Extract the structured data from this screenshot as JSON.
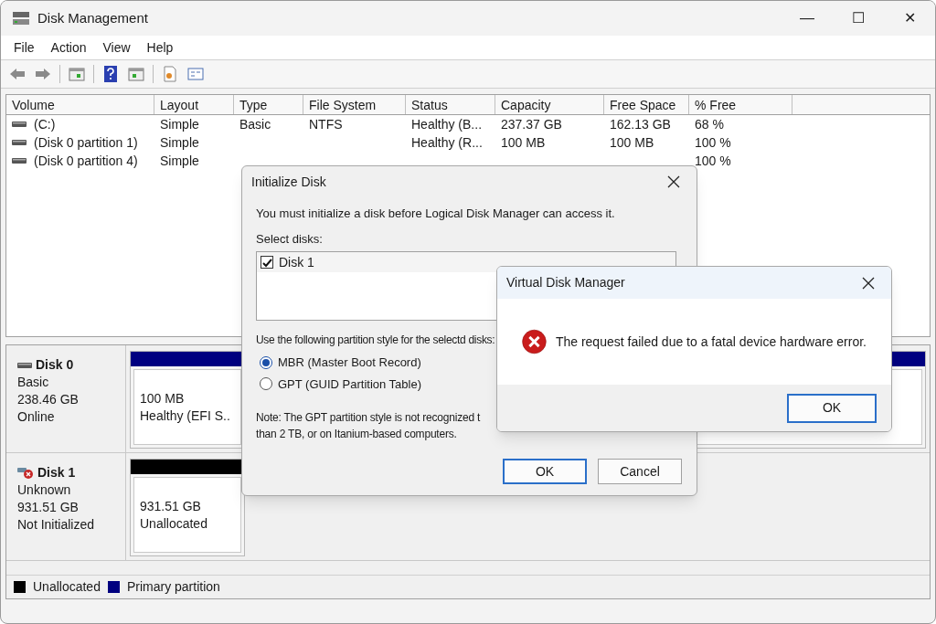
{
  "window": {
    "title": "Disk Management",
    "controls": [
      "—",
      "☐",
      "✕"
    ]
  },
  "menu": [
    "File",
    "Action",
    "View",
    "Help"
  ],
  "table": {
    "columns": [
      "Volume",
      "Layout",
      "Type",
      "File System",
      "Status",
      "Capacity",
      "Free Space",
      "% Free"
    ],
    "rows": [
      {
        "volume": "(C:)",
        "layout": "Simple",
        "type": "Basic",
        "file_system": "NTFS",
        "status": "Healthy (B...",
        "capacity": "237.37 GB",
        "free_space": "162.13 GB",
        "percent_free": "68 %"
      },
      {
        "volume": "(Disk 0 partition 1)",
        "layout": "Simple",
        "status": "Healthy (R...",
        "capacity": "100 MB",
        "free_space": "100 MB",
        "percent_free": "100 %"
      },
      {
        "volume": "(Disk 0 partition 4)",
        "layout": "Simple",
        "percent_free": "100 %"
      }
    ]
  },
  "disks": [
    {
      "name": "Disk 0",
      "error": false,
      "lines": [
        "Basic",
        "238.46 GB",
        "Online"
      ],
      "partitions": [
        {
          "color": "#000080",
          "size": "100 MB",
          "status": "Healthy (EFI S.."
        },
        {
          "color": "#000080"
        }
      ]
    },
    {
      "name": "Disk 1",
      "error": true,
      "lines": [
        "Unknown",
        "931.51 GB",
        "Not Initialized"
      ],
      "partitions": [
        {
          "color": "#000000",
          "size": "931.51 GB",
          "status": "Unallocated"
        }
      ]
    }
  ],
  "legend": [
    {
      "label": "Unallocated",
      "color": "#000000"
    },
    {
      "label": "Primary partition",
      "color": "#000080"
    }
  ],
  "init_dialog": {
    "title": "Initialize Disk",
    "message": "You must initialize a disk before Logical Disk Manager can access it.",
    "select_label": "Select disks:",
    "disks": [
      {
        "label": "Disk 1",
        "checked": true
      }
    ],
    "style_label": "Use the following partition style for the selectd disks:",
    "options": [
      {
        "label": "MBR (Master Boot Record)",
        "selected": true
      },
      {
        "label": "GPT (GUID Partition Table)",
        "selected": false
      }
    ],
    "note_lines": [
      "Note: The GPT partition style is not recognized t",
      "than 2 TB, or on Itanium-based computers."
    ],
    "buttons": [
      {
        "label": "OK",
        "default": true
      },
      {
        "label": "Cancel",
        "default": false
      }
    ]
  },
  "error_dialog": {
    "title": "Virtual Disk Manager",
    "message": "The request failed due to a fatal device hardware error.",
    "buttons": [
      {
        "label": "OK",
        "default": true
      }
    ]
  }
}
